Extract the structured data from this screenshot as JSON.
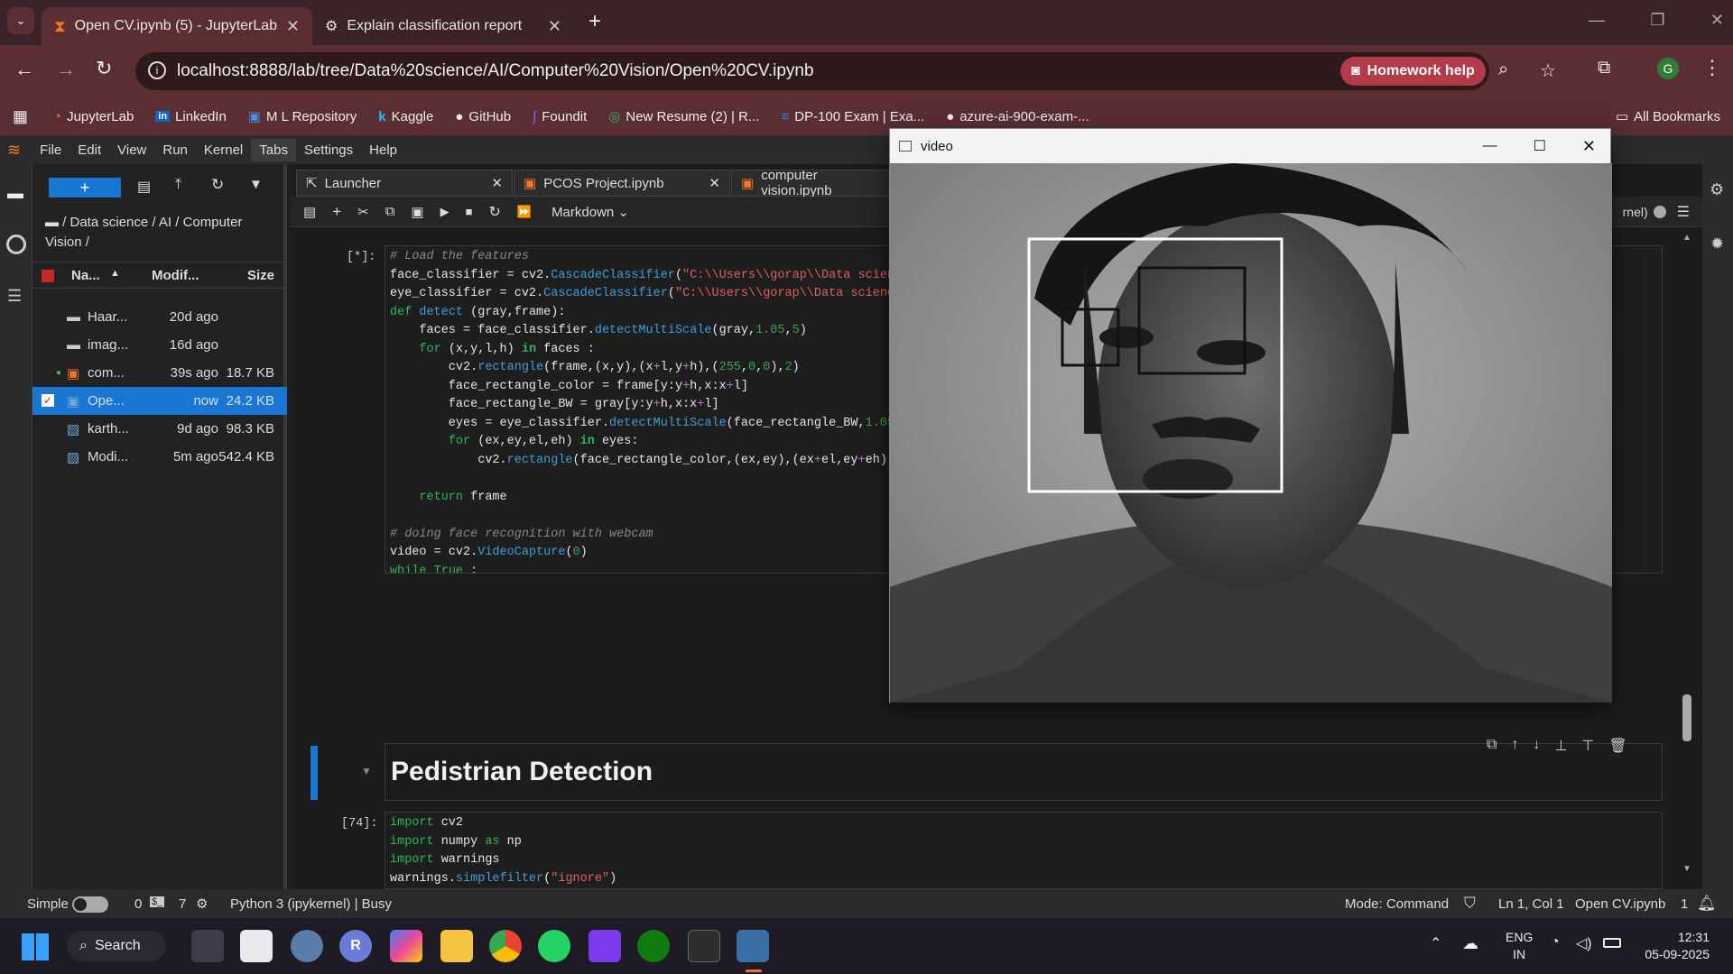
{
  "browser": {
    "tabs": [
      {
        "title": "Open CV.ipynb (5) - JupyterLab",
        "close": "✕"
      },
      {
        "title": "Explain classification report",
        "close": "✕"
      }
    ],
    "new_tab": "+",
    "url": "localhost:8888/lab/tree/Data%20science/AI/Computer%20Vision/Open%20CV.ipynb",
    "homework": "Homework help",
    "profile": "G",
    "bookmarks": [
      "JupyterLab",
      "LinkedIn",
      "M L Repository",
      "Kaggle",
      "GitHub",
      "Foundit",
      "New Resume (2) | R...",
      "DP-100 Exam | Exa...",
      "azure-ai-900-exam-..."
    ],
    "all_bookmarks": "All Bookmarks"
  },
  "jupyter": {
    "menus": [
      "File",
      "Edit",
      "View",
      "Run",
      "Kernel",
      "Tabs",
      "Settings",
      "Help"
    ],
    "breadcrumb": "/ Data science / AI / Computer Vision /",
    "columns": {
      "name": "Na...",
      "modified": "Modif...",
      "size": "Size"
    },
    "files": [
      {
        "name": "Haar...",
        "mod": "20d ago",
        "size": "",
        "type": "folder"
      },
      {
        "name": "imag...",
        "mod": "16d ago",
        "size": "",
        "type": "folder"
      },
      {
        "name": "com...",
        "mod": "39s ago",
        "size": "18.7 KB",
        "type": "notebook-orange"
      },
      {
        "name": "Ope...",
        "mod": "now",
        "size": "24.2 KB",
        "type": "notebook"
      },
      {
        "name": "karth...",
        "mod": "9d ago",
        "size": "98.3 KB",
        "type": "image"
      },
      {
        "name": "Modi...",
        "mod": "5m ago",
        "size": "542.4 KB",
        "type": "image"
      }
    ],
    "doc_tabs": [
      "Launcher",
      "PCOS Project.ipynb",
      "computer vision.ipynb"
    ],
    "cell_type": "Markdown",
    "kernel_label": "rnel)",
    "prompt1": "[*]:",
    "heading": "Pedistrian Detection",
    "prompt2": "[74]:",
    "status": {
      "mode_label": "Simple",
      "terminals": "0",
      "kernels": "7",
      "kernel": "Python 3 (ipykernel) | Busy",
      "mode": "Mode: Command",
      "pos": "Ln 1, Col 1",
      "file": "Open CV.ipynb",
      "notif": "1"
    }
  },
  "video_window": {
    "title": "video"
  },
  "taskbar": {
    "search": "Search",
    "lang1": "ENG",
    "lang2": "IN",
    "time": "12:31",
    "date": "05-09-2025"
  }
}
